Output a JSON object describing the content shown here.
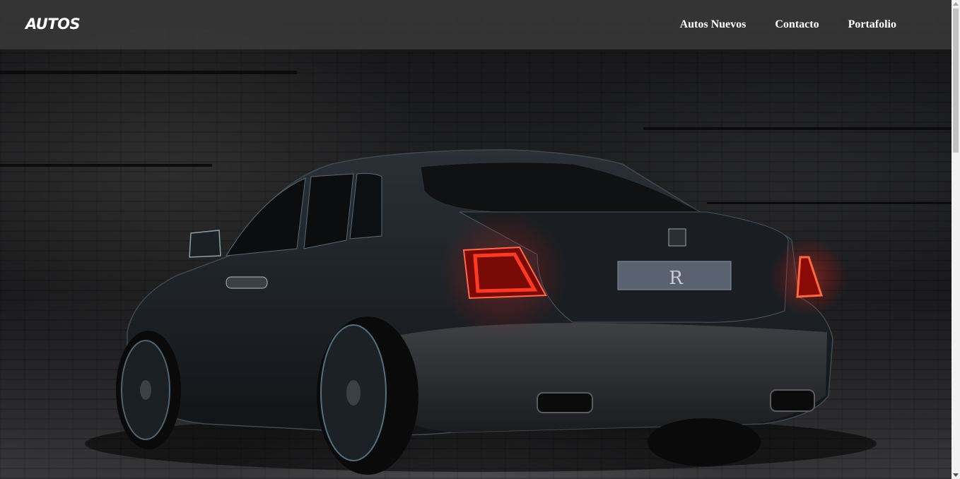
{
  "header": {
    "logo": "AUTOS",
    "nav": [
      {
        "label": "Autos Nuevos"
      },
      {
        "label": "Contacto"
      },
      {
        "label": "Portafolio"
      }
    ]
  },
  "hero": {
    "image_subject": "car-rear-view-photo"
  },
  "colors": {
    "navbar_bg": "#3a3a3a",
    "nav_text": "#ffffff",
    "taillight": "#ff2a1a"
  }
}
